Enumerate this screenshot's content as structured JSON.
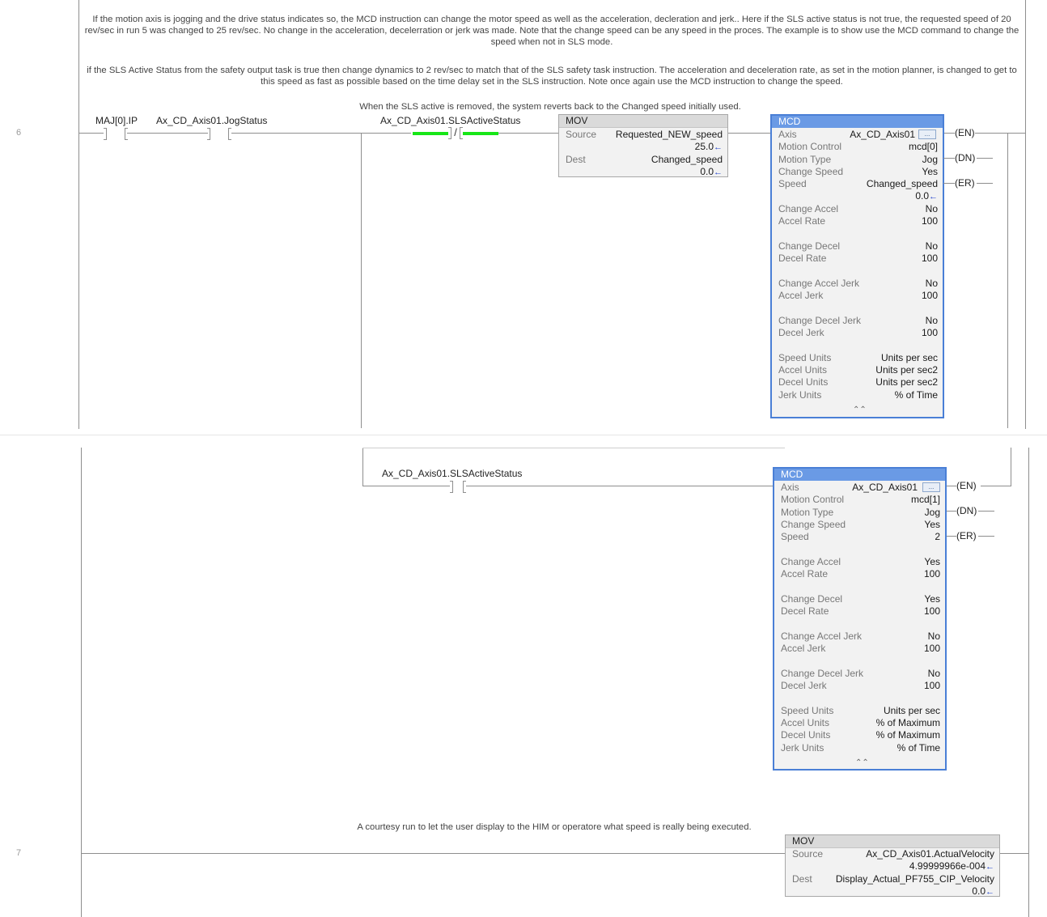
{
  "rung6": {
    "number": "6",
    "comment1": "If the motion axis is jogging and the drive status indicates so, the MCD instruction can change the motor speed as well as the acceleration, decleration and jerk..  Here if the SLS active status is not true,  the requested speed of 20 rev/sec in run 5 was changed to 25 rev/sec.   No change in the acceleration, decelerration or jerk was made.   Note that the change speed can be any speed in the proces.  The example is to show use the MCD command to change the speed when not in SLS mode.",
    "comment2": "if the SLS Active Status from the safety output task is true then change dynamics to 2 rev/sec to match that of the SLS safety task instruction.   The acceleration and deceleration rate, as set in the motion planner, is changed to get to this speed as fast as possible based on the time delay set in the SLS instruction.   Note once again use the MCD instruction to change the speed.",
    "comment3": "When the SLS active is removed, the system reverts back to the Changed speed initially used.",
    "contact1_tag": "MAJ[0].IP",
    "contact2_tag": "Ax_CD_Axis01.JogStatus",
    "contact3_tag": "Ax_CD_Axis01.SLSActiveStatus",
    "branch_contact_tag": "Ax_CD_Axis01.SLSActiveStatus",
    "mov": {
      "title": "MOV",
      "source_label": "Source",
      "source_tag": "Requested_NEW_speed",
      "source_value": "25.0",
      "dest_label": "Dest",
      "dest_tag": "Changed_speed",
      "dest_value": "0.0"
    },
    "mcd_top": {
      "title": "MCD",
      "axis_label": "Axis",
      "axis_value": "Ax_CD_Axis01",
      "motion_control_label": "Motion Control",
      "motion_control_value": "mcd[0]",
      "motion_type_label": "Motion Type",
      "motion_type_value": "Jog",
      "change_speed_label": "Change Speed",
      "change_speed_value": "Yes",
      "speed_label": "Speed",
      "speed_value": "Changed_speed",
      "speed_live": "0.0",
      "change_accel_label": "Change Accel",
      "change_accel_value": "No",
      "accel_rate_label": "Accel Rate",
      "accel_rate_value": "100",
      "change_decel_label": "Change Decel",
      "change_decel_value": "No",
      "decel_rate_label": "Decel Rate",
      "decel_rate_value": "100",
      "change_accel_jerk_label": "Change Accel Jerk",
      "change_accel_jerk_value": "No",
      "accel_jerk_label": "Accel Jerk",
      "accel_jerk_value": "100",
      "change_decel_jerk_label": "Change Decel Jerk",
      "change_decel_jerk_value": "No",
      "decel_jerk_label": "Decel Jerk",
      "decel_jerk_value": "100",
      "speed_units_label": "Speed Units",
      "speed_units_value": "Units per sec",
      "accel_units_label": "Accel Units",
      "accel_units_value": "Units per sec2",
      "decel_units_label": "Decel Units",
      "decel_units_value": "Units per sec2",
      "jerk_units_label": "Jerk Units",
      "jerk_units_value": "% of Time",
      "en": "EN",
      "dn": "DN",
      "er": "ER"
    },
    "mcd_branch": {
      "title": "MCD",
      "axis_label": "Axis",
      "axis_value": "Ax_CD_Axis01",
      "motion_control_label": "Motion Control",
      "motion_control_value": "mcd[1]",
      "motion_type_label": "Motion Type",
      "motion_type_value": "Jog",
      "change_speed_label": "Change Speed",
      "change_speed_value": "Yes",
      "speed_label": "Speed",
      "speed_value": "2",
      "change_accel_label": "Change Accel",
      "change_accel_value": "Yes",
      "accel_rate_label": "Accel Rate",
      "accel_rate_value": "100",
      "change_decel_label": "Change Decel",
      "change_decel_value": "Yes",
      "decel_rate_label": "Decel Rate",
      "decel_rate_value": "100",
      "change_accel_jerk_label": "Change Accel Jerk",
      "change_accel_jerk_value": "No",
      "accel_jerk_label": "Accel Jerk",
      "accel_jerk_value": "100",
      "change_decel_jerk_label": "Change Decel Jerk",
      "change_decel_jerk_value": "No",
      "decel_jerk_label": "Decel Jerk",
      "decel_jerk_value": "100",
      "speed_units_label": "Speed Units",
      "speed_units_value": "Units per sec",
      "accel_units_label": "Accel Units",
      "accel_units_value": "% of Maximum",
      "decel_units_label": "Decel Units",
      "decel_units_value": "% of Maximum",
      "jerk_units_label": "Jerk Units",
      "jerk_units_value": "% of Time",
      "en": "EN",
      "dn": "DN",
      "er": "ER"
    }
  },
  "rung7": {
    "number": "7",
    "comment": "A courtesy run to let the user display to the HIM or operatore what speed is really being executed.",
    "mov": {
      "title": "MOV",
      "source_label": "Source",
      "source_tag": "Ax_CD_Axis01.ActualVelocity",
      "source_value": "4.99999966e-004",
      "dest_label": "Dest",
      "dest_tag": "Display_Actual_PF755_CIP_Velocity",
      "dest_value": "0.0"
    }
  },
  "icons": {
    "arrow": "←",
    "browse": "...",
    "collapse": "double-chevron-up"
  },
  "colors": {
    "mcd_border": "#4a7fd6",
    "mcd_title": "#6a9ae5",
    "energized": "#17e617",
    "live_arrow": "#2244cc"
  }
}
